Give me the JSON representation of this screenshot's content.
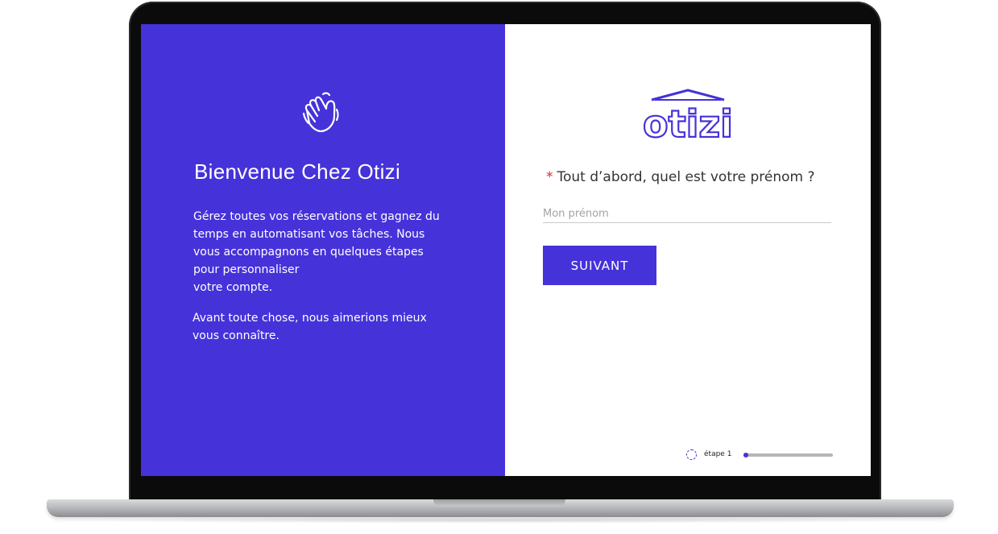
{
  "left_panel": {
    "title": "Bienvenue Chez Otizi",
    "paragraph1_lines": [
      "Gérez toutes vos réservations et gagnez du",
      "temps en automatisant vos tâches. Nous",
      "vous accompagnons en quelques étapes",
      "pour personnaliser",
      "votre compte."
    ],
    "paragraph2_lines": [
      "Avant toute chose, nous aimerions mieux",
      "vous connaître."
    ],
    "icon": "waving-hand-icon",
    "background_color": "#4632d9"
  },
  "right_panel": {
    "logo_text": "otizi",
    "question": {
      "required_marker": "*",
      "text": "Tout d’abord, quel est votre prénom ?"
    },
    "first_name_input": {
      "placeholder": "Mon prénom",
      "value": ""
    },
    "next_button_label": "SUIVANT",
    "progress": {
      "label": "étape 1",
      "value": 0.05
    }
  },
  "colors": {
    "accent": "#4632d9",
    "required": "#e02424"
  }
}
